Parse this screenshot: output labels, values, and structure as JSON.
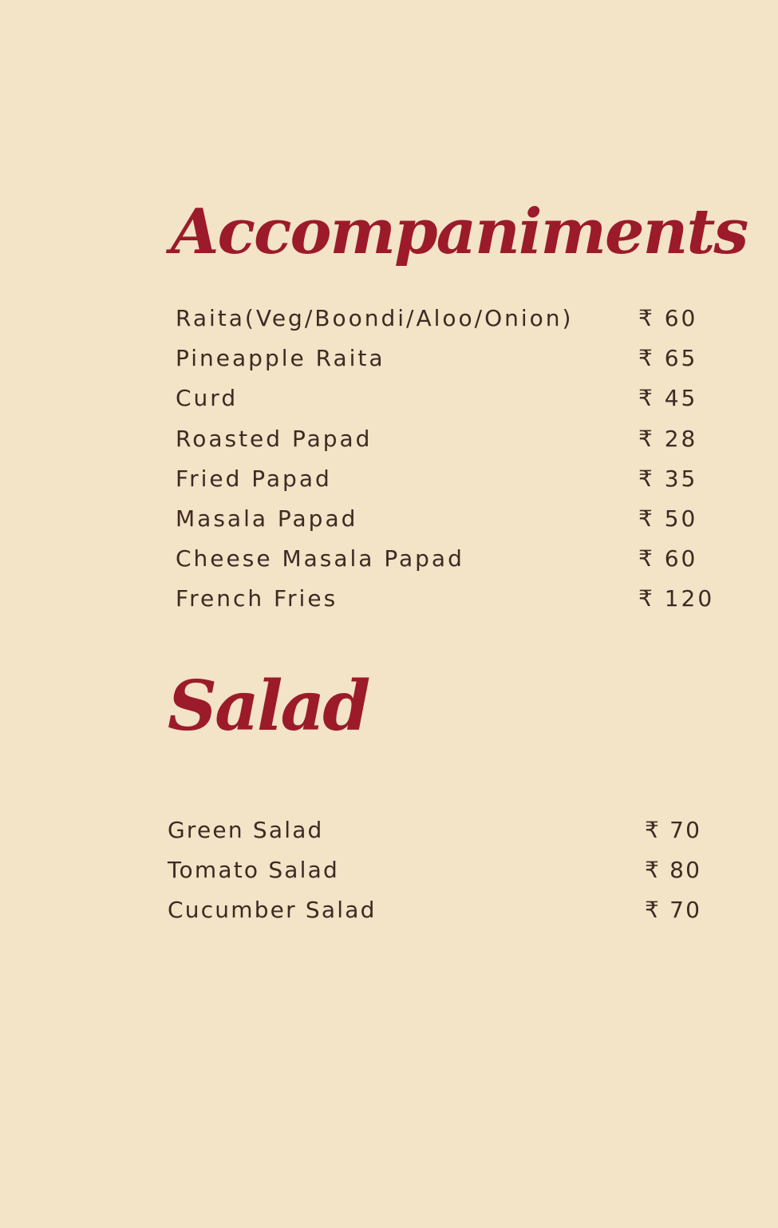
{
  "accompaniments": {
    "title": "Accompaniments",
    "items": [
      {
        "name": "Raita(Veg/Boondi/Aloo/Onion)",
        "price": "₹ 60"
      },
      {
        "name": "Pineapple Raita",
        "price": "₹ 65"
      },
      {
        "name": "Curd",
        "price": "₹ 45"
      },
      {
        "name": "Roasted Papad",
        "price": "₹ 28"
      },
      {
        "name": "Fried Papad",
        "price": "₹ 35"
      },
      {
        "name": "Masala Papad",
        "price": "₹ 50"
      },
      {
        "name": "Cheese Masala Papad",
        "price": "₹ 60"
      },
      {
        "name": "French Fries",
        "price": "₹ 120"
      }
    ]
  },
  "salad": {
    "title": "Salad",
    "items": [
      {
        "name": "Green Salad",
        "price": "₹ 70"
      },
      {
        "name": "Tomato Salad",
        "price": "₹ 80"
      },
      {
        "name": "Cucumber Salad",
        "price": "₹ 70"
      }
    ]
  },
  "colors": {
    "background": "#f3e3c7",
    "heading": "#9b1b2a",
    "text": "#3e2a22"
  }
}
